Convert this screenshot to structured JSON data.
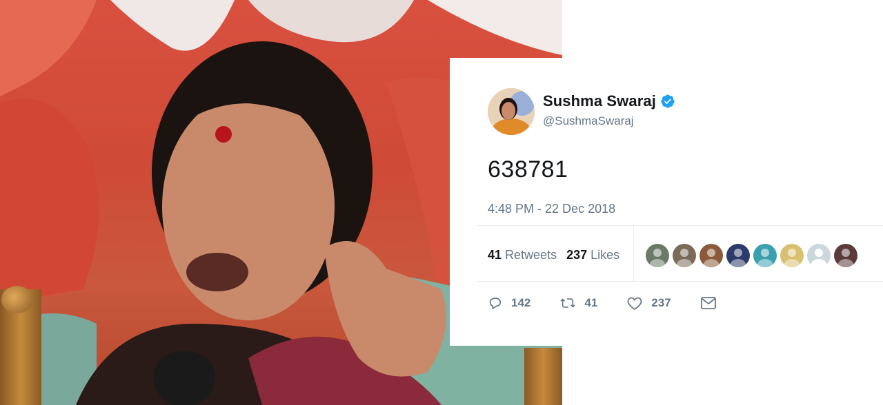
{
  "tweet": {
    "display_name": "Sushma Swaraj",
    "handle": "@SushmaSwaraj",
    "text": "638781",
    "timestamp": "4:48 PM - 22 Dec 2018",
    "stats": {
      "retweets_count": "41",
      "retweets_label": "Retweets",
      "likes_count": "237",
      "likes_label": "Likes"
    },
    "actions": {
      "reply_count": "142",
      "retweet_count": "41",
      "like_count": "237"
    },
    "verified_color": "#1da1f2",
    "icons": [
      "verified-badge-icon",
      "reply-icon",
      "retweet-icon",
      "heart-icon",
      "mail-icon"
    ]
  },
  "likers": [
    {
      "name": "liker-1",
      "color": "#6b7a66"
    },
    {
      "name": "liker-2",
      "color": "#7a6a58"
    },
    {
      "name": "liker-3",
      "color": "#8a5a3a"
    },
    {
      "name": "liker-4",
      "color": "#2b3a6a"
    },
    {
      "name": "liker-5",
      "color": "#3aa0b0"
    },
    {
      "name": "liker-6",
      "color": "#d8c070"
    },
    {
      "name": "liker-7",
      "color": "#ccd6dd"
    },
    {
      "name": "liker-8",
      "color": "#5a3a3a"
    }
  ],
  "colors": {
    "text_primary": "#14171a",
    "text_secondary": "#657786",
    "divider": "#e6ecf0",
    "photo_background": "#cf4a37"
  }
}
